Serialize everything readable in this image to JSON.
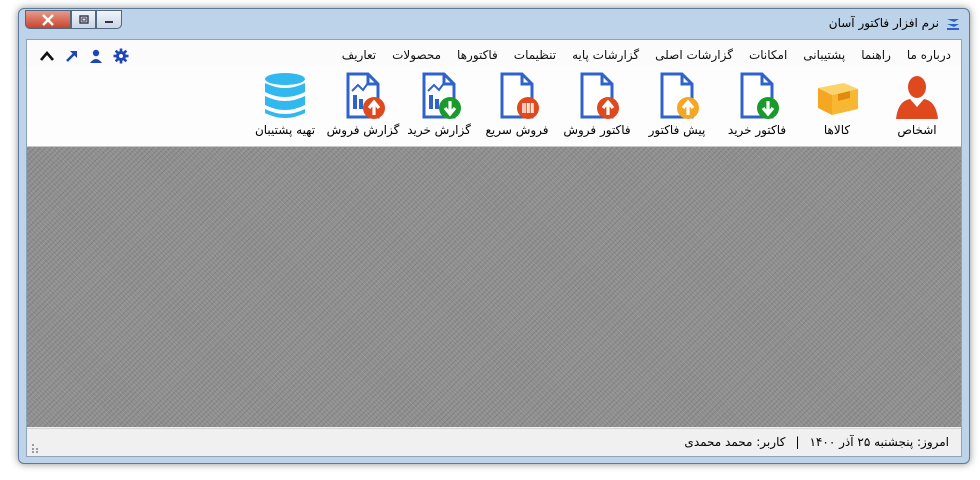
{
  "window": {
    "title": "نرم افزار فاکتور آسان"
  },
  "menu": {
    "items": [
      "تعاریف",
      "محصولات",
      "فاکتورها",
      "تنظیمات",
      "گزارشات پایه",
      "گزارشات اصلی",
      "امکانات",
      "پشتیبانی",
      "راهنما",
      "درباره ما"
    ]
  },
  "toolbar": {
    "tools": [
      {
        "label": "اشخاص",
        "icon": "person-icon"
      },
      {
        "label": "کالاها",
        "icon": "box-icon"
      },
      {
        "label": "فاکتور خرید",
        "icon": "purchase-invoice-icon"
      },
      {
        "label": "پیش فاکتور",
        "icon": "pre-invoice-icon"
      },
      {
        "label": "فاکتور فروش",
        "icon": "sales-invoice-icon"
      },
      {
        "label": "فروش سریع",
        "icon": "barcode-document-icon"
      },
      {
        "label": "گزارش خرید",
        "icon": "purchase-report-icon"
      },
      {
        "label": "گزارش فروش",
        "icon": "sales-report-icon"
      },
      {
        "label": "تهیه پشتیبان",
        "icon": "database-icon"
      }
    ]
  },
  "status": {
    "today": "امروز: پنجشنبه ۲۵ آذر ۱۴۰۰",
    "separator": "|",
    "user": "کاربر: محمد محمدی"
  },
  "colors": {
    "accent_blue": "#2f63c9",
    "green": "#1a9a2a",
    "orange_red": "#e0481e",
    "amber": "#f5a623",
    "db_cyan": "#31b8ef"
  }
}
